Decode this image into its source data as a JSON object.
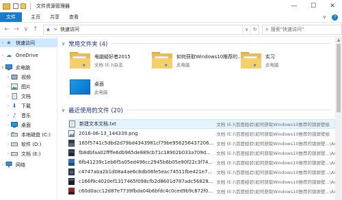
{
  "window": {
    "title": "文件资源管理器",
    "buttons": {
      "minimize": "—",
      "maximize": "☐",
      "close": "✕"
    }
  },
  "ribbon": {
    "tabs": [
      "文件",
      "主页",
      "共享",
      "查看"
    ],
    "expand": "∨",
    "help": "?"
  },
  "address": {
    "back": "←",
    "forward": "→",
    "recent": "∨",
    "up": "↑",
    "path_root_separator": ">",
    "path": "快速访问",
    "refresh": "↻",
    "dropdown": "∨",
    "search_placeholder": "搜索\"快速访问\""
  },
  "sidebar": {
    "items": [
      {
        "label": "快速访问",
        "icon": "star-icon",
        "color": "#2a6fcf",
        "active": true
      },
      {
        "label": "OneDrive",
        "icon": "cloud-icon",
        "color": "#1479d6"
      },
      {
        "label": "此电脑",
        "icon": "computer-icon",
        "color": "#3b8fd8"
      },
      {
        "label": "视频",
        "icon": "video-icon",
        "color": "#556"
      },
      {
        "label": "图片",
        "icon": "picture-icon",
        "color": "#556"
      },
      {
        "label": "文档",
        "icon": "document-icon",
        "color": "#556"
      },
      {
        "label": "下载",
        "icon": "download-icon",
        "color": "#2a6fcf"
      },
      {
        "label": "音乐",
        "icon": "music-icon",
        "color": "#2a6fcf"
      },
      {
        "label": "桌面",
        "icon": "desktop-icon",
        "color": "#1a9be8"
      },
      {
        "label": "本地磁盘 (C:)",
        "icon": "drive-icon",
        "color": "#777"
      },
      {
        "label": "软件 (D:)",
        "icon": "drive-icon",
        "color": "#777"
      },
      {
        "label": "文档 (E:)",
        "icon": "drive-icon",
        "color": "#777"
      },
      {
        "label": "网络",
        "icon": "network-icon",
        "color": "#2a6fcf"
      }
    ]
  },
  "frequent": {
    "title": "常用文件夹 (4)",
    "folders": [
      {
        "name": "电脑疑好者2015",
        "sub": "文档 (E:)\\杂志"
      },
      {
        "name": "如何获取Windows10推荐的...",
        "sub": "此电脑"
      },
      {
        "name": "实习",
        "sub": "此电脑"
      },
      {
        "name": "桌面",
        "sub": "此电脑"
      }
    ]
  },
  "recent": {
    "title": "最近使用的文件 (20)",
    "files": [
      {
        "name": "新建文本文档.txt",
        "path": "文档 (E:)\\百度经验\\如何获取Windows10推荐的锁屏壁纸",
        "type": "txt"
      },
      {
        "name": "2016-06-13_144339.png",
        "path": "文档 (E:)\\百度经验\\如何获取Windows10推荐的锁屏壁纸",
        "type": "png"
      },
      {
        "name": "165f5741c5dbd2d79bd4343981cf79be956256437206...",
        "path": "文档 (E:)\\百度经验\\如何获取Windows10推荐的锁屏壁...\\Assets",
        "type": "img-dark"
      },
      {
        "name": "fb8dbfaa02ffffe6db965de889cb71c18902b033a709d...",
        "path": "文档 (E:)\\百度经验\\如何获取Windows10推荐的锁屏壁...\\Assets",
        "type": "img-dark"
      },
      {
        "name": "6fb41239c1eb6f5a05ed496cc2945b6b05e90f22c3f74...",
        "path": "文档 (E:)\\百度经验\\如何获取Windows10推荐的锁屏壁...\\Assets",
        "type": "img-blue"
      },
      {
        "name": "c4747aba2b1d08a4ae6c6db06fe5eac74511fbe421e7...",
        "path": "文档 (E:)\\百度经验\\如何获取Windows10推荐的锁屏壁...\\Assets",
        "type": "img-dark"
      },
      {
        "name": "c166f9c4020ef1317465f098cfb2d8601d787adc56828...",
        "path": "文档 (E:)\\百度经验\\如何获取Windows10推荐的锁屏壁...\\Assets",
        "type": "img-dark"
      },
      {
        "name": "c60d0acc12d87e7739fbda04b6bfdc4c0ced9b9c872f0...",
        "path": "文档 (E:)\\百度经验\\如何获取Windows10推荐的锁屏壁...\\Assets",
        "type": "img-red"
      }
    ]
  },
  "colors": {
    "accent": "#1979ca",
    "group_title": "#1e3287",
    "selection": "#cde8ff",
    "folder": "#f4cf6a"
  }
}
